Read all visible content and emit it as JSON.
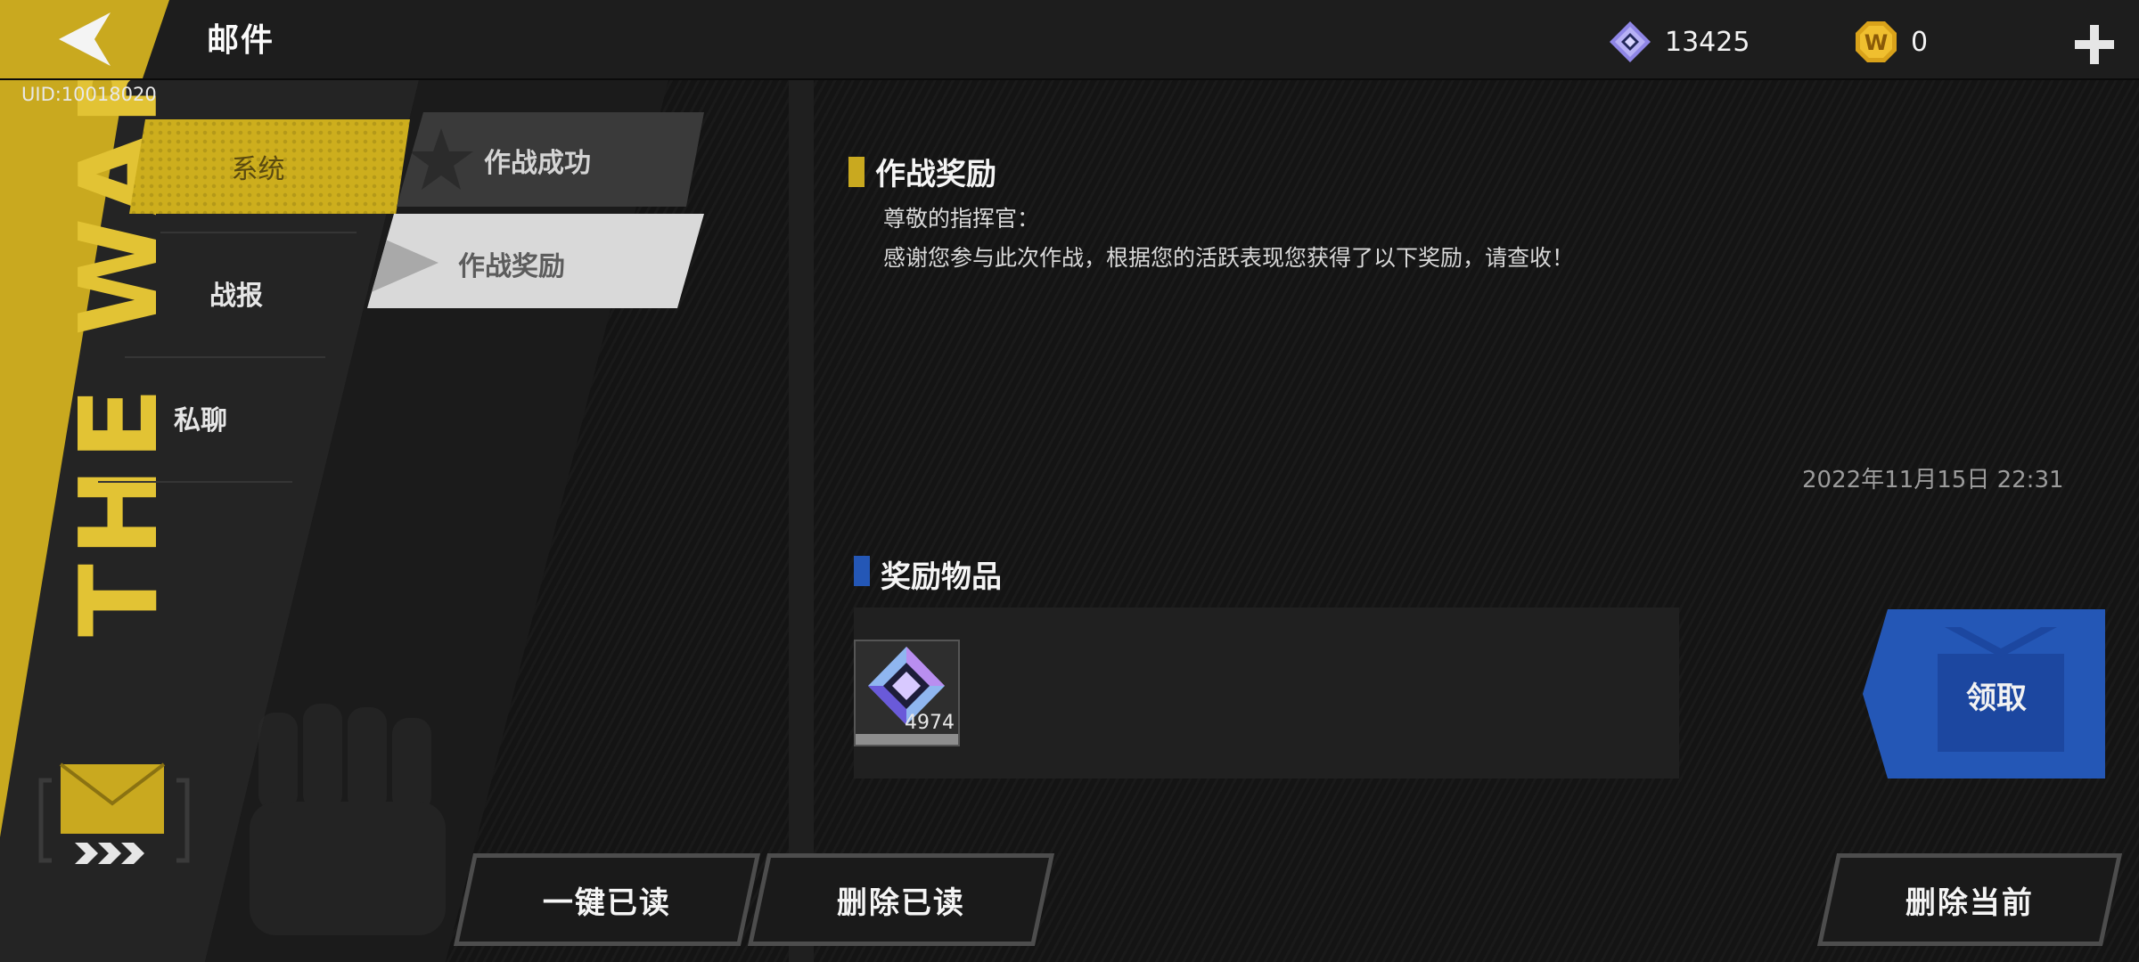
{
  "header": {
    "title": "邮件",
    "uid": "UID:10018020",
    "gem_count": "13425",
    "coin_count": "0"
  },
  "categories": [
    {
      "label": "系统",
      "active": true
    },
    {
      "label": "战报",
      "active": false
    },
    {
      "label": "私聊",
      "active": false
    }
  ],
  "mail_list": [
    {
      "title": "作战成功",
      "icon": "star-icon",
      "selected": false
    },
    {
      "title": "作战奖励",
      "icon": "play-icon",
      "selected": true
    }
  ],
  "mail": {
    "subject": "作战奖励",
    "greeting": "尊敬的指挥官：",
    "body": "感谢您参与此次作战，根据您的活跃表现您获得了以下奖励，请查收！",
    "date": "2022年11月15日 22:31"
  },
  "rewards": {
    "title": "奖励物品",
    "items": [
      {
        "icon": "gem-icon",
        "count": "4974"
      }
    ],
    "claim_label": "领取"
  },
  "actions": {
    "mark_all_read": "一键已读",
    "delete_read": "删除已读",
    "delete_current": "删除当前"
  },
  "colors": {
    "accent_yellow": "#c9a91f",
    "accent_blue": "#2457b6",
    "background": "#141414"
  }
}
